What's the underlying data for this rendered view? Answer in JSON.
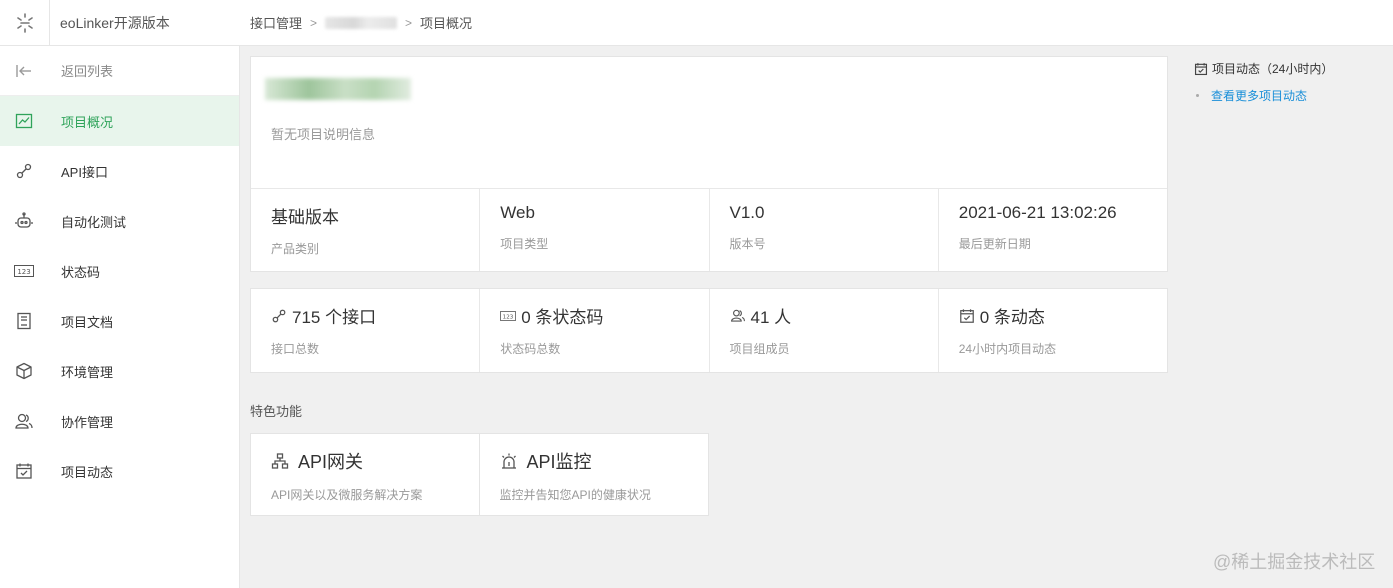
{
  "app": {
    "title": "eoLinker开源版本"
  },
  "breadcrumb": {
    "first": "接口管理",
    "last": "项目概况"
  },
  "sidebar": {
    "back": "返回列表",
    "items": [
      {
        "label": "项目概况",
        "icon": "trend-chart-icon"
      },
      {
        "label": "API接口",
        "icon": "link-icon"
      },
      {
        "label": "自动化测试",
        "icon": "robot-icon"
      },
      {
        "label": "状态码",
        "icon": "code-123-icon"
      },
      {
        "label": "项目文档",
        "icon": "document-icon"
      },
      {
        "label": "环境管理",
        "icon": "cube-icon"
      },
      {
        "label": "协作管理",
        "icon": "users-icon"
      },
      {
        "label": "项目动态",
        "icon": "calendar-check-icon"
      }
    ]
  },
  "project": {
    "description": "暂无项目说明信息",
    "info": [
      {
        "value": "基础版本",
        "label": "产品类别"
      },
      {
        "value": "Web",
        "label": "项目类型"
      },
      {
        "value": "V1.0",
        "label": "版本号"
      },
      {
        "value": "2021-06-21 13:02:26",
        "label": "最后更新日期"
      }
    ],
    "stats": [
      {
        "value": "715 个接口",
        "label": "接口总数",
        "icon": "link-icon"
      },
      {
        "value": "0 条状态码",
        "label": "状态码总数",
        "icon": "code-123-icon"
      },
      {
        "value": "41 人",
        "label": "项目组成员",
        "icon": "users-icon"
      },
      {
        "value": "0 条动态",
        "label": "24小时内项目动态",
        "icon": "calendar-check-icon"
      }
    ]
  },
  "features": {
    "title": "特色功能",
    "items": [
      {
        "value": "API网关",
        "label": "API网关以及微服务解决方案",
        "icon": "network-icon"
      },
      {
        "value": "API监控",
        "label": "监控并告知您API的健康状况",
        "icon": "alarm-icon"
      }
    ]
  },
  "activity": {
    "title": "项目动态（24小时内）",
    "more_link": "查看更多项目动态"
  },
  "watermark": "@稀土掘金技术社区",
  "colors": {
    "accent": "#2fa35a",
    "active_bg": "#e8f5ec",
    "link": "#1a8fd8"
  }
}
